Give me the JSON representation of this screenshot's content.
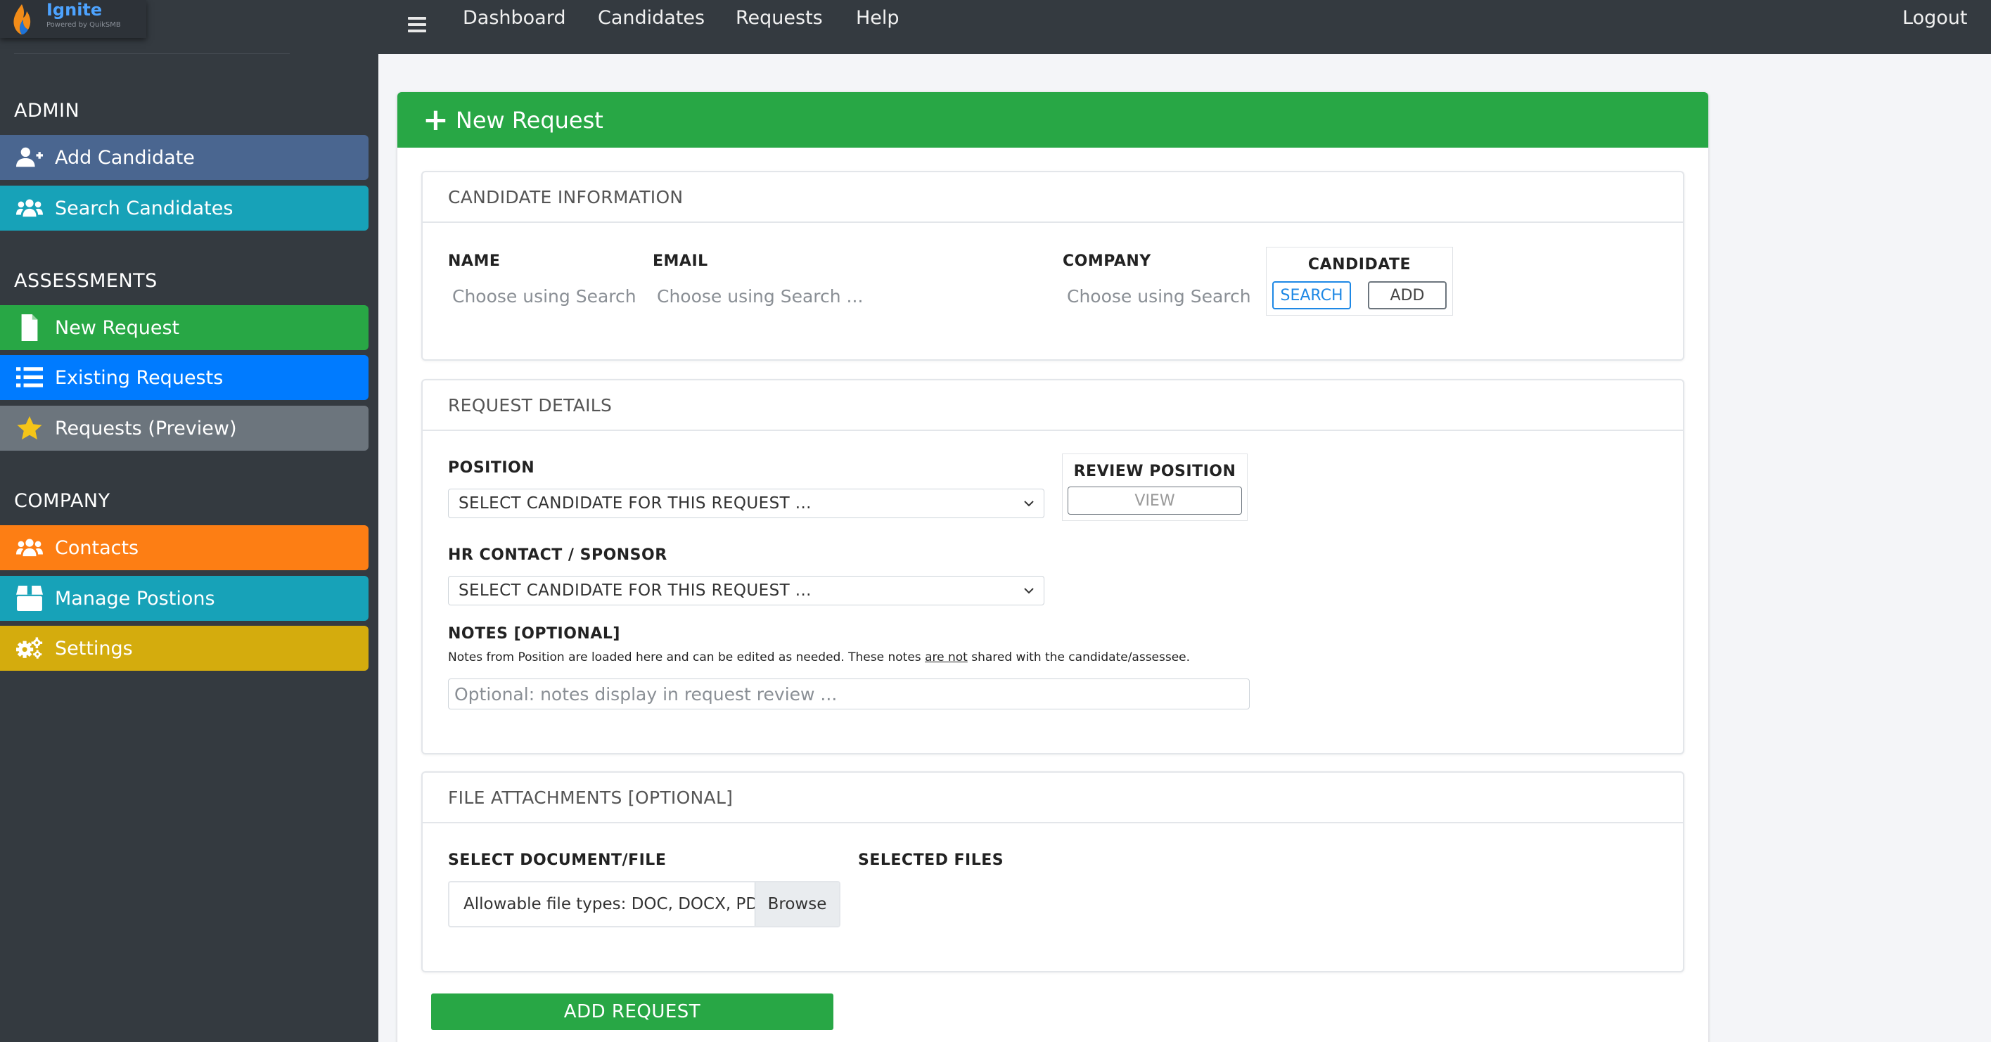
{
  "logo": {
    "name": "Ignite",
    "tagline": "Powered by QuikSMB"
  },
  "sidebar": {
    "sections": [
      {
        "title": "ADMIN"
      },
      {
        "title": "ASSESSMENTS"
      },
      {
        "title": "COMPANY"
      }
    ],
    "items": [
      {
        "label": "Add Candidate",
        "icon": "user-plus-icon",
        "color": "#4a6690"
      },
      {
        "label": "Search Candidates",
        "icon": "users-icon",
        "color": "#17a2b8"
      },
      {
        "label": "New Request",
        "icon": "file-icon",
        "color": "#28a745"
      },
      {
        "label": "Existing Requests",
        "icon": "list-icon",
        "color": "#007bff"
      },
      {
        "label": "Requests (Preview)",
        "icon": "star-icon",
        "color": "#6c757d"
      },
      {
        "label": "Contacts",
        "icon": "users-icon",
        "color": "#fd7e14"
      },
      {
        "label": "Manage Postions",
        "icon": "box-icon",
        "color": "#17a2b8"
      },
      {
        "label": "Settings",
        "icon": "gears-icon",
        "color": "#d4ac0d"
      }
    ]
  },
  "topnav": {
    "items": [
      "Dashboard",
      "Candidates",
      "Requests",
      "Help"
    ],
    "logout": "Logout"
  },
  "card": {
    "title": "New Request"
  },
  "candidate_info": {
    "heading": "CANDIDATE INFORMATION",
    "name_label": "NAME",
    "name_value": "Choose using Search",
    "email_label": "EMAIL",
    "email_value": "Choose using Search ...",
    "company_label": "COMPANY",
    "company_value": "Choose using Search",
    "candidate_label": "CANDIDATE",
    "search_button": "SEARCH",
    "add_button": "ADD"
  },
  "request_details": {
    "heading": "REQUEST DETAILS",
    "position_label": "POSITION",
    "position_selected": "SELECT CANDIDATE FOR THIS REQUEST ...",
    "review_label": "REVIEW POSITION",
    "view_button": "VIEW",
    "hr_label": "HR CONTACT / SPONSOR",
    "hr_selected": "SELECT CANDIDATE FOR THIS REQUEST ...",
    "notes_label": "NOTES [OPTIONAL]",
    "notes_help_before": "Notes from Position are loaded here and can be edited as needed. These notes ",
    "notes_help_emph": "are not",
    "notes_help_after": " shared with the candidate/assessee.",
    "notes_placeholder": "Optional: notes display in request review ..."
  },
  "attachments": {
    "heading": "FILE ATTACHMENTS [OPTIONAL]",
    "select_label": "SELECT DOCUMENT/FILE",
    "file_placeholder": "Allowable file types: DOC, DOCX, PDF, TXT",
    "browse_button": "Browse",
    "selected_label": "SELECTED FILES"
  },
  "add_request_button": "ADD REQUEST"
}
